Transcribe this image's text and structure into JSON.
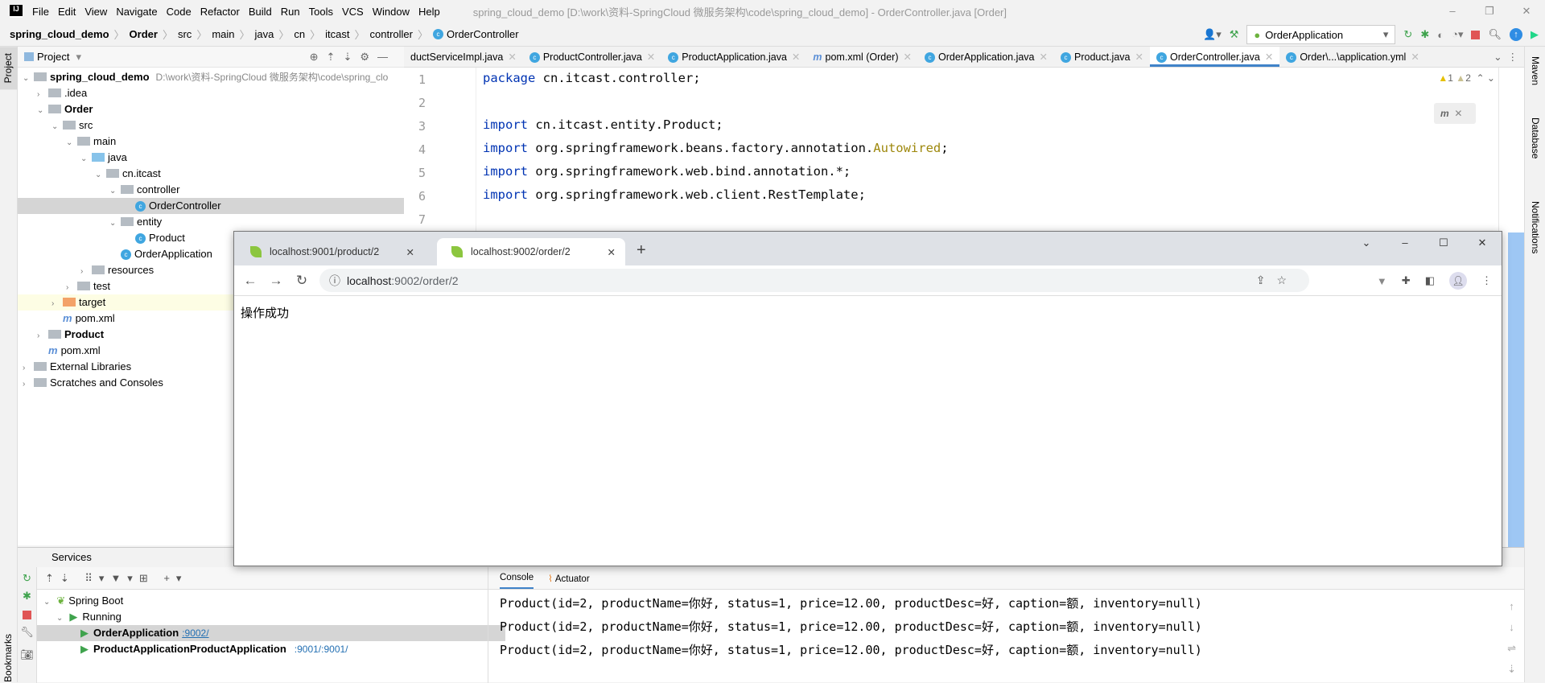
{
  "menubar": {
    "items": [
      "File",
      "Edit",
      "View",
      "Navigate",
      "Code",
      "Refactor",
      "Build",
      "Run",
      "Tools",
      "VCS",
      "Window",
      "Help"
    ],
    "title": "spring_cloud_demo [D:\\work\\资料-SpringCloud 微服务架构\\code\\spring_cloud_demo] - OrderController.java [Order]"
  },
  "breadcrumb": [
    "spring_cloud_demo",
    "Order",
    "src",
    "main",
    "java",
    "cn",
    "itcast",
    "controller",
    "OrderController"
  ],
  "toolbar": {
    "run_config": "OrderApplication"
  },
  "left_strip": {
    "project": "Project",
    "bookmarks": "Bookmarks"
  },
  "project": {
    "title": "Project",
    "tree": [
      {
        "label": "spring_cloud_demo",
        "hint": "D:\\work\\资料-SpringCloud 微服务架构\\code\\spring_clo",
        "bold": true,
        "depth": 0,
        "open": true
      },
      {
        "label": ".idea",
        "depth": 1,
        "open": false
      },
      {
        "label": "Order",
        "bold": true,
        "depth": 1,
        "open": true
      },
      {
        "label": "src",
        "depth": 2,
        "open": true
      },
      {
        "label": "main",
        "depth": 3,
        "open": true
      },
      {
        "label": "java",
        "depth": 4,
        "open": true
      },
      {
        "label": "cn.itcast",
        "depth": 5,
        "open": true
      },
      {
        "label": "controller",
        "depth": 6,
        "open": true
      },
      {
        "label": "OrderController",
        "depth": 7,
        "type": "class",
        "selected": true
      },
      {
        "label": "entity",
        "depth": 6,
        "open": true
      },
      {
        "label": "Product",
        "depth": 7,
        "type": "class"
      },
      {
        "label": "OrderApplication",
        "depth": 6,
        "type": "class"
      },
      {
        "label": "resources",
        "depth": 4,
        "open": false
      },
      {
        "label": "test",
        "depth": 3,
        "open": false
      },
      {
        "label": "target",
        "depth": 2,
        "open": false,
        "highlight": true
      },
      {
        "label": "pom.xml",
        "depth": 2,
        "type": "maven"
      },
      {
        "label": "Product",
        "bold": true,
        "depth": 1,
        "open": false
      },
      {
        "label": "pom.xml",
        "depth": 1,
        "type": "maven"
      },
      {
        "label": "External Libraries",
        "depth": 0,
        "open": false
      },
      {
        "label": "Scratches and Consoles",
        "depth": 0,
        "open": false
      }
    ]
  },
  "editor": {
    "tabs": [
      "ductServiceImpl.java",
      "ProductController.java",
      "ProductApplication.java",
      "pom.xml (Order)",
      "OrderApplication.java",
      "Product.java",
      "OrderController.java",
      "Order\\...\\application.yml"
    ],
    "active_tab": 6,
    "warnings": "1",
    "weak_warnings": "2",
    "lines": [
      {
        "n": "1",
        "kw": "package",
        "rest": " cn.itcast.controller;"
      },
      {
        "n": "2",
        "kw": "",
        "rest": ""
      },
      {
        "n": "3",
        "kw": "import",
        "rest": " cn.itcast.entity.Product;"
      },
      {
        "n": "4",
        "kw": "import",
        "rest": " org.springframework.beans.factory.annotation.",
        "ann": "Autowired",
        "tail": ";"
      },
      {
        "n": "5",
        "kw": "import",
        "rest": " org.springframework.web.bind.annotation.*;"
      },
      {
        "n": "6",
        "kw": "import",
        "rest": " org.springframework.web.client.RestTemplate;"
      },
      {
        "n": "7",
        "kw": "",
        "rest": ""
      }
    ]
  },
  "right_strip": [
    "Maven",
    "Database",
    "Notifications"
  ],
  "services": {
    "title": "Services",
    "tree": [
      {
        "label": "Spring Boot"
      },
      {
        "label": "Running"
      },
      {
        "label": "OrderApplication",
        "port": ":9002/"
      },
      {
        "label": "ProductApplicationProductApplication",
        "port": ":9001/:9001/"
      }
    ],
    "console_tabs": [
      "Console",
      "Actuator"
    ],
    "console_lines": [
      "Product(id=2, productName=你好, status=1, price=12.00, productDesc=好, caption=额, inventory=null)",
      "Product(id=2, productName=你好, status=1, price=12.00, productDesc=好, caption=额, inventory=null)",
      "Product(id=2, productName=你好, status=1, price=12.00, productDesc=好, caption=额, inventory=null)"
    ]
  },
  "browser": {
    "tabs": [
      "localhost:9001/product/2",
      "localhost:9002/order/2"
    ],
    "active_tab": 1,
    "url_host": "localhost",
    "url_path": ":9002/order/2",
    "content": "操作成功"
  }
}
